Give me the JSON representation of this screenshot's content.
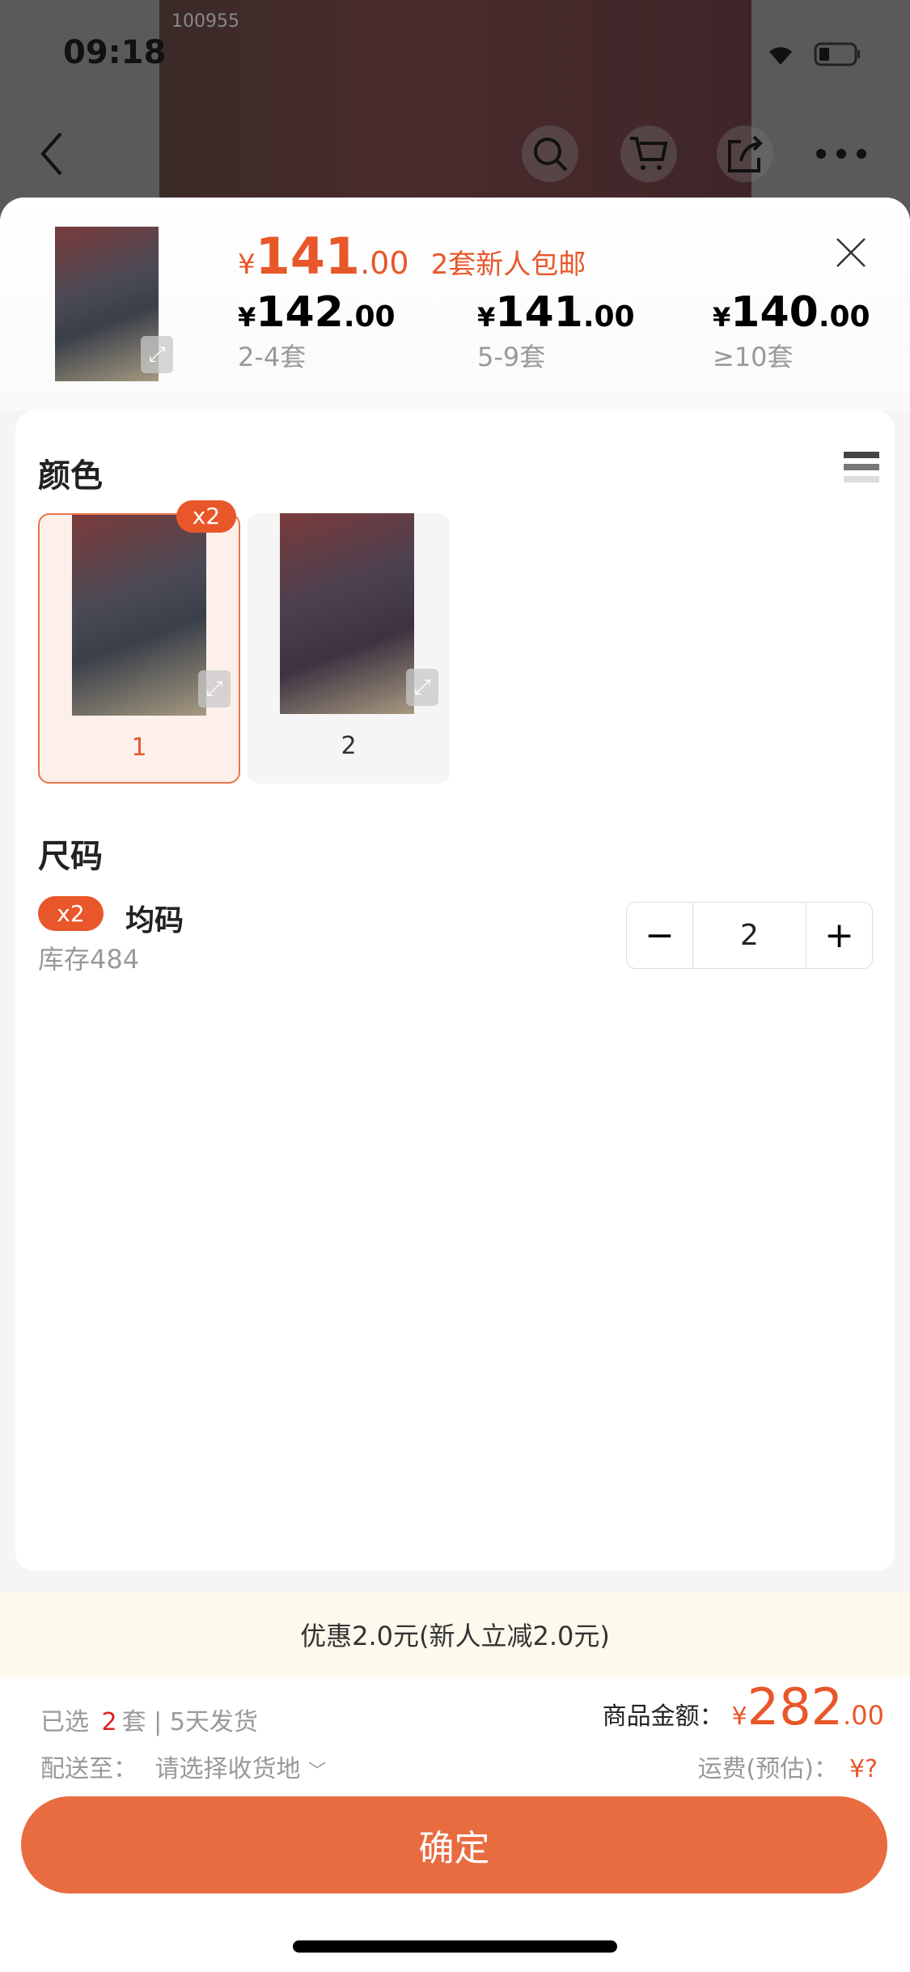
{
  "status": {
    "time": "09:18"
  },
  "hero": {
    "watermark": "100955"
  },
  "product": {
    "price_symbol": "¥",
    "price_int": "141",
    "price_dec": ".00",
    "promo_tag": "2套新人包邮",
    "tiers": [
      {
        "symbol": "¥",
        "int": "142",
        "dec": ".00",
        "range": "2-4套"
      },
      {
        "symbol": "¥",
        "int": "141",
        "dec": ".00",
        "range": "5-9套"
      },
      {
        "symbol": "¥",
        "int": "140",
        "dec": ".00",
        "range": "≥10套"
      }
    ]
  },
  "color": {
    "title": "颜色",
    "options": [
      {
        "label": "1",
        "badge": "x2",
        "selected": true
      },
      {
        "label": "2",
        "selected": false
      }
    ]
  },
  "size": {
    "title": "尺码",
    "badge": "x2",
    "name": "均码",
    "stock": "库存484",
    "quantity": "2",
    "minus": "−",
    "plus": "+"
  },
  "promo": {
    "text": "优惠2.0元(新人立减2.0元)"
  },
  "summary": {
    "selected_prefix": "已选",
    "selected_count": "2",
    "selected_suffix": "套 | 5天发货",
    "ship_label": "配送至：",
    "ship_value": "请选择收货地",
    "amount_label": "商品金额：",
    "amount_symbol": "¥",
    "amount_int": "282",
    "amount_dec": ".00",
    "freight_label": "运费(预估)：",
    "freight_value": "¥?"
  },
  "confirm": {
    "label": "确定"
  },
  "colors": {
    "accent": "#e8572a",
    "button": "#e96b40"
  }
}
